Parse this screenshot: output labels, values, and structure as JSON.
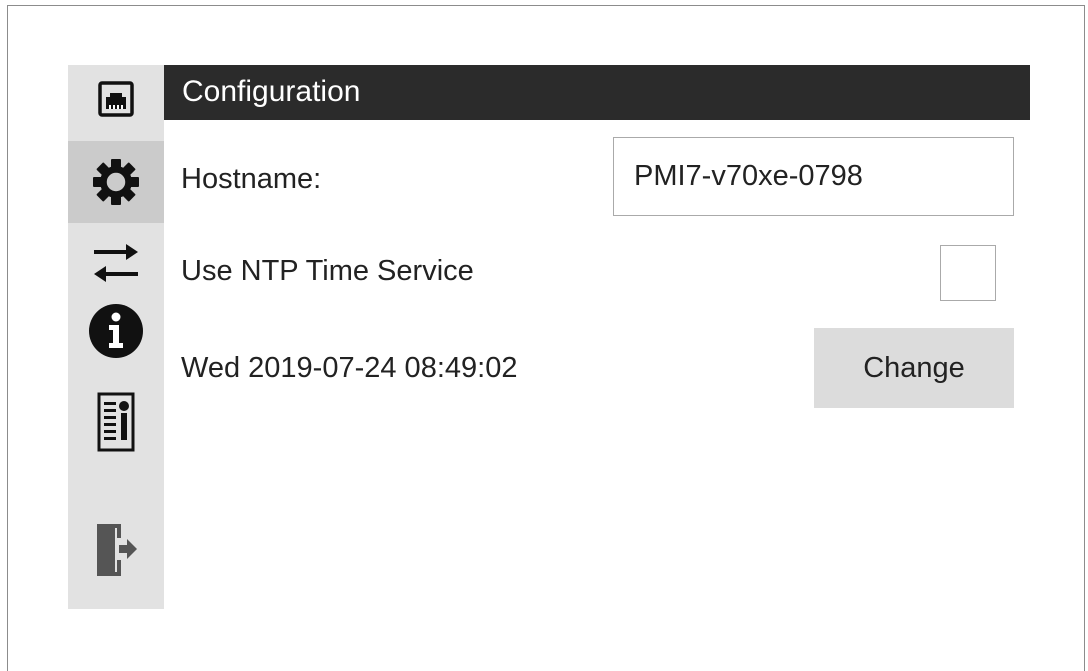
{
  "header": {
    "title": "Configuration"
  },
  "sidebar": {
    "items": [
      {
        "icon": "network-port-icon",
        "active": false
      },
      {
        "icon": "gear-icon",
        "active": true
      },
      {
        "icon": "transfer-arrows-icon",
        "active": false
      },
      {
        "icon": "info-icon",
        "active": false
      },
      {
        "icon": "certificate-document-icon",
        "active": false
      },
      {
        "icon": "logout-door-icon",
        "active": false
      }
    ]
  },
  "form": {
    "hostname_label": "Hostname:",
    "hostname_value": "PMI7-v70xe-0798",
    "ntp_label": "Use NTP Time Service",
    "ntp_checked": false,
    "datetime": "Wed 2019-07-24 08:49:02",
    "change_label": "Change"
  },
  "colors": {
    "header_bg": "#2b2b2b",
    "sidebar_bg": "#e2e2e2",
    "sidebar_active_bg": "#cbcbcb",
    "button_bg": "#dcdcdc"
  }
}
